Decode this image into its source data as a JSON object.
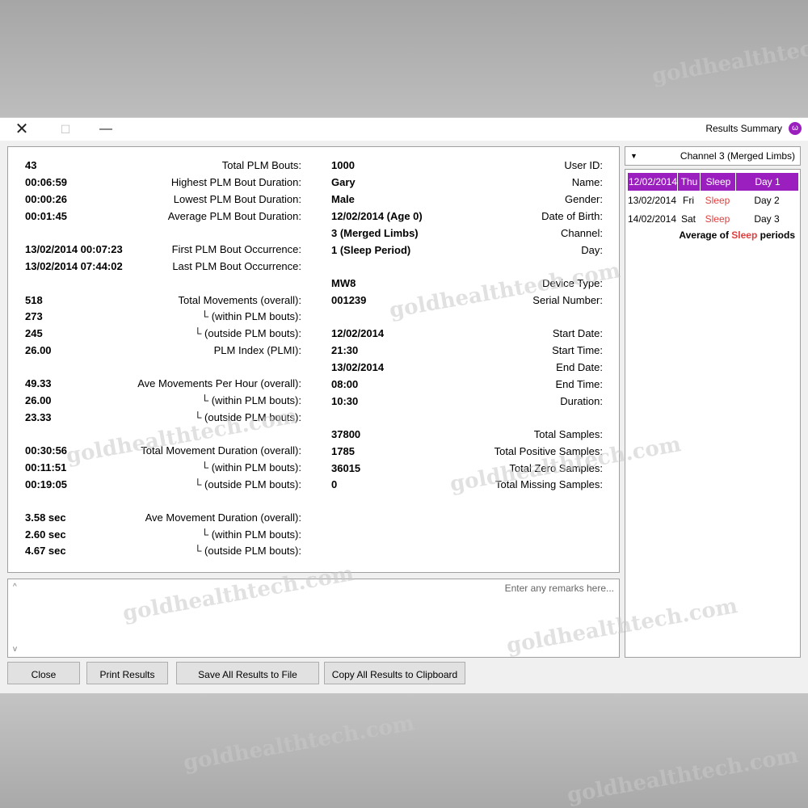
{
  "window": {
    "title": "Results Summary",
    "close_glyph": "✕",
    "maximize_glyph": "☐",
    "minimize_glyph": "—",
    "app_icon_glyph": "ω"
  },
  "info": [
    {
      "label": "User ID:",
      "value": "1000"
    },
    {
      "label": "Name:",
      "value": "Gary"
    },
    {
      "label": "Gender:",
      "value": "Male"
    },
    {
      "label": "Date of Birth:",
      "value": "12/02/2014 (Age 0)"
    },
    {
      "label": "Channel:",
      "value": "3 (Merged Limbs)"
    },
    {
      "label": "Day:",
      "value": "1 (Sleep Period)"
    },
    {
      "label": "Device Type:",
      "value": "MW8"
    },
    {
      "label": "Serial Number:",
      "value": "001239"
    },
    {
      "label": "Start Date:",
      "value": "12/02/2014"
    },
    {
      "label": "Start Time:",
      "value": "21:30"
    },
    {
      "label": "End Date:",
      "value": "13/02/2014"
    },
    {
      "label": "End Time:",
      "value": "08:00"
    },
    {
      "label": "Duration:",
      "value": "10:30"
    },
    {
      "label": "Total Samples:",
      "value": "37800"
    },
    {
      "label": "Total Positive Samples:",
      "value": "1785"
    },
    {
      "label": "Total Zero Samples:",
      "value": "36015"
    },
    {
      "label": "Total Missing Samples:",
      "value": "0"
    }
  ],
  "stats": [
    {
      "label": "Total PLM Bouts:",
      "value": "43"
    },
    {
      "label": "Highest PLM Bout Duration:",
      "value": "00:06:59"
    },
    {
      "label": "Lowest PLM Bout Duration:",
      "value": "00:00:26"
    },
    {
      "label": "Average PLM Bout Duration:",
      "value": "00:01:45"
    },
    {
      "label": "First PLM Bout Occurrence:",
      "value": "13/02/2014 00:07:23"
    },
    {
      "label": "Last PLM Bout Occurrence:",
      "value": "13/02/2014 07:44:02"
    },
    {
      "label": "Total Movements (overall):",
      "value": "518"
    },
    {
      "label": "└ (within PLM bouts):",
      "value": "273"
    },
    {
      "label": "└ (outside PLM bouts):",
      "value": "245"
    },
    {
      "label": "PLM Index (PLMI):",
      "value": "26.00"
    },
    {
      "label": "Ave Movements Per Hour (overall):",
      "value": "49.33"
    },
    {
      "label": "└ (within PLM bouts):",
      "value": "26.00"
    },
    {
      "label": "└ (outside PLM bouts):",
      "value": "23.33"
    },
    {
      "label": "Total Movement Duration (overall):",
      "value": "00:30:56"
    },
    {
      "label": "└ (within PLM bouts):",
      "value": "00:11:51"
    },
    {
      "label": "└ (outside PLM bouts):",
      "value": "00:19:05"
    },
    {
      "label": "Ave Movement Duration (overall):",
      "value": "3.58 sec"
    },
    {
      "label": "└ (within PLM bouts):",
      "value": "2.60 sec"
    },
    {
      "label": "└ (outside PLM bouts):",
      "value": "4.67 sec"
    }
  ],
  "remarks": {
    "placeholder": "Enter any remarks here..."
  },
  "channel_select": {
    "selected": "Channel 3 (Merged Limbs)",
    "arrow_glyph": "▼"
  },
  "days": [
    {
      "day": "Day 1",
      "sleep": "Sleep",
      "weekday": "Thu",
      "date": "12/02/2014",
      "selected": true
    },
    {
      "day": "Day 2",
      "sleep": "Sleep",
      "weekday": "Fri",
      "date": "13/02/2014",
      "selected": false
    },
    {
      "day": "Day 3",
      "sleep": "Sleep",
      "weekday": "Sat",
      "date": "14/02/2014",
      "selected": false
    }
  ],
  "average": {
    "prefix": "Average of",
    "sleep": "Sleep",
    "suffix": "periods"
  },
  "buttons": {
    "copy": "Copy All Results to Clipboard",
    "save": "Save All Results to File",
    "print": "Print Results",
    "close": "Close"
  },
  "watermark": "goldhealthtech.com",
  "colors": {
    "selected_row": "#9b1fbf",
    "sleep_text": "#e04040"
  }
}
